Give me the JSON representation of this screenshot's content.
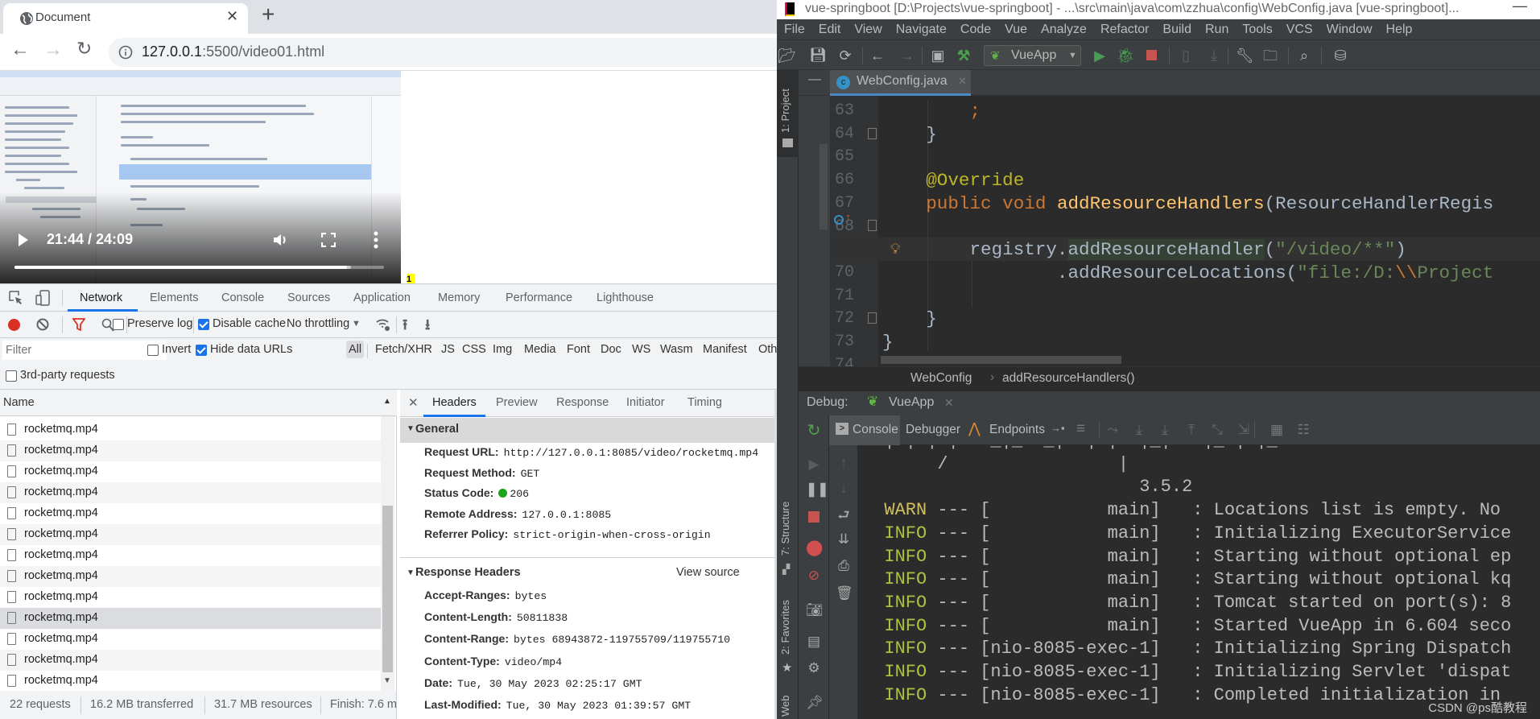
{
  "browser": {
    "tab_title": "Document",
    "tab_icon": "globe-icon",
    "url_host": "127.0.0.1",
    "url_path": ":5500/video01.html",
    "video": {
      "time_display": "21:44 / 24:09",
      "current_time": "21:44",
      "duration": "24:09",
      "played_fraction": 0.9,
      "buffered_fraction": 0.91
    },
    "page_marker": "1"
  },
  "devtools": {
    "tabs": [
      "Network",
      "Elements",
      "Console",
      "Sources",
      "Application",
      "Memory",
      "Performance",
      "Lighthouse"
    ],
    "active_tab": "Network",
    "toolbar": {
      "preserve_log": {
        "label": "Preserve log",
        "checked": false
      },
      "disable_cache": {
        "label": "Disable cache",
        "checked": true
      },
      "throttling": "No throttling"
    },
    "filter": {
      "placeholder": "Filter",
      "invert": {
        "label": "Invert",
        "checked": false
      },
      "hide_data_urls": {
        "label": "Hide data URLs",
        "checked": true
      },
      "types": [
        "All",
        "Fetch/XHR",
        "JS",
        "CSS",
        "Img",
        "Media",
        "Font",
        "Doc",
        "WS",
        "Wasm",
        "Manifest",
        "Oth"
      ],
      "active_type": "All",
      "third_party": {
        "label": "3rd-party requests",
        "checked": false
      }
    },
    "requests": {
      "column_header": "Name",
      "rows": [
        "rocketmq.mp4",
        "rocketmq.mp4",
        "rocketmq.mp4",
        "rocketmq.mp4",
        "rocketmq.mp4",
        "rocketmq.mp4",
        "rocketmq.mp4",
        "rocketmq.mp4",
        "rocketmq.mp4",
        "rocketmq.mp4",
        "rocketmq.mp4",
        "rocketmq.mp4",
        "rocketmq.mp4"
      ],
      "selected_index": 9
    },
    "status_bar": [
      "22 requests",
      "16.2 MB transferred",
      "31.7 MB resources",
      "Finish: 7.6 m"
    ],
    "details": {
      "tabs": [
        "Headers",
        "Preview",
        "Response",
        "Initiator",
        "Timing"
      ],
      "active_tab": "Headers",
      "general": {
        "title": "General",
        "fields": [
          {
            "label": "Request URL:",
            "value": "http://127.0.0.1:8085/video/rocketmq.mp4"
          },
          {
            "label": "Request Method:",
            "value": "GET"
          },
          {
            "label": "Status Code:",
            "value": "206",
            "status_color": "#1aa51a"
          },
          {
            "label": "Remote Address:",
            "value": "127.0.0.1:8085"
          },
          {
            "label": "Referrer Policy:",
            "value": "strict-origin-when-cross-origin"
          }
        ]
      },
      "response_headers": {
        "title": "Response Headers",
        "view_source": "View source",
        "fields": [
          {
            "label": "Accept-Ranges:",
            "value": "bytes"
          },
          {
            "label": "Content-Length:",
            "value": "50811838"
          },
          {
            "label": "Content-Range:",
            "value": "bytes 68943872-119755709/119755710"
          },
          {
            "label": "Content-Type:",
            "value": "video/mp4"
          },
          {
            "label": "Date:",
            "value": "Tue, 30 May 2023 02:25:17 GMT"
          },
          {
            "label": "Last-Modified:",
            "value": "Tue, 30 May 2023 01:39:57 GMT"
          }
        ]
      }
    }
  },
  "ide": {
    "title": "vue-springboot [D:\\Projects\\vue-springboot] - ...\\src\\main\\java\\com\\zzhua\\config\\WebConfig.java [vue-springboot]...",
    "menu": [
      "File",
      "Edit",
      "View",
      "Navigate",
      "Code",
      "Vue",
      "Analyze",
      "Refactor",
      "Build",
      "Run",
      "Tools",
      "VCS",
      "Window",
      "Help"
    ],
    "run_config": "VueApp",
    "left_stripe": {
      "project": "1: Project",
      "structure": "7: Structure",
      "favorites": "2: Favorites",
      "web": "Web"
    },
    "editor_tab": "WebConfig.java",
    "code_lines": [
      {
        "n": "63",
        "tokens": [
          {
            "t": "        "
          },
          {
            "t": ";",
            "c": "kw"
          }
        ]
      },
      {
        "n": "64",
        "tokens": [
          {
            "t": "    }"
          }
        ]
      },
      {
        "n": "65",
        "tokens": []
      },
      {
        "n": "66",
        "tokens": [
          {
            "t": "    "
          },
          {
            "t": "@Override",
            "c": "an"
          }
        ]
      },
      {
        "n": "67",
        "tokens": [
          {
            "t": "    "
          },
          {
            "t": "public void ",
            "c": "kw"
          },
          {
            "t": "addResourceHandlers",
            "c": "fn"
          },
          {
            "t": "(ResourceHandlerRegis"
          }
        ]
      },
      {
        "n": "68",
        "tokens": []
      },
      {
        "n": "69",
        "tokens": [
          {
            "t": "        registry."
          },
          {
            "t": "addResourceHandler",
            "c": "mhl"
          },
          {
            "t": "("
          },
          {
            "t": "\"/video/**\"",
            "c": "st"
          },
          {
            "t": ")"
          }
        ],
        "current": true
      },
      {
        "n": "70",
        "tokens": [
          {
            "t": "                .addResourceLocations("
          },
          {
            "t": "\"file:/D:",
            "c": "st"
          },
          {
            "t": "\\\\",
            "c": "esc"
          },
          {
            "t": "Project",
            "c": "st"
          }
        ]
      },
      {
        "n": "71",
        "tokens": []
      },
      {
        "n": "72",
        "tokens": [
          {
            "t": "    }"
          }
        ]
      },
      {
        "n": "73",
        "tokens": [
          {
            "t": "}"
          }
        ]
      },
      {
        "n": "74",
        "tokens": []
      }
    ],
    "breadcrumb": [
      "WebConfig",
      "addResourceHandlers()"
    ],
    "debug": {
      "label": "Debug:",
      "session": "VueApp",
      "tabs": [
        "Console",
        "Debugger",
        "Endpoints"
      ],
      "active_tab": "Console"
    },
    "console_lines": [
      {
        "level": "",
        "text": "  | | | |  \\_|_/\\_|  | |  |_|   |_/| |_"
      },
      {
        "level": "",
        "text": "       /                |"
      },
      {
        "level": "",
        "text": "                          3.5.2"
      },
      {
        "level": "WARN",
        "text": " --- [           main]   : Locations list is empty. No"
      },
      {
        "level": "INFO",
        "text": " --- [           main]   : Initializing ExecutorService"
      },
      {
        "level": "INFO",
        "text": " --- [           main]   : Starting without optional ep"
      },
      {
        "level": "INFO",
        "text": " --- [           main]   : Starting without optional kq"
      },
      {
        "level": "INFO",
        "text": " --- [           main]   : Tomcat started on port(s): 8"
      },
      {
        "level": "INFO",
        "text": " --- [           main]   : Started VueApp in 6.604 seco"
      },
      {
        "level": "INFO",
        "text": " --- [nio-8085-exec-1]   : Initializing Spring Dispatch"
      },
      {
        "level": "INFO",
        "text": " --- [nio-8085-exec-1]   : Initializing Servlet 'dispat"
      },
      {
        "level": "INFO",
        "text": " --- [nio-8085-exec-1]   : Completed initialization in"
      }
    ],
    "watermark": "CSDN @ps酷教程"
  }
}
